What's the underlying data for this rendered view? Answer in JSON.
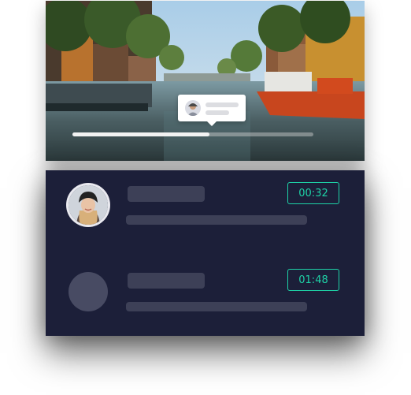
{
  "video": {
    "progress": 0.57,
    "tooltip": {
      "icon": "commenter-avatar"
    }
  },
  "comments": [
    {
      "avatar": "woman-with-beanie-photo",
      "timestamp": "00:32",
      "placeholder": false
    },
    {
      "avatar": "avatar-placeholder",
      "timestamp": "01:48",
      "placeholder": true
    }
  ],
  "colors": {
    "panel_background": "#1c1f39",
    "skeleton_bar": "#3d4057",
    "accent_teal": "#1ed3a7",
    "progress_fill": "#f2f2f2"
  }
}
